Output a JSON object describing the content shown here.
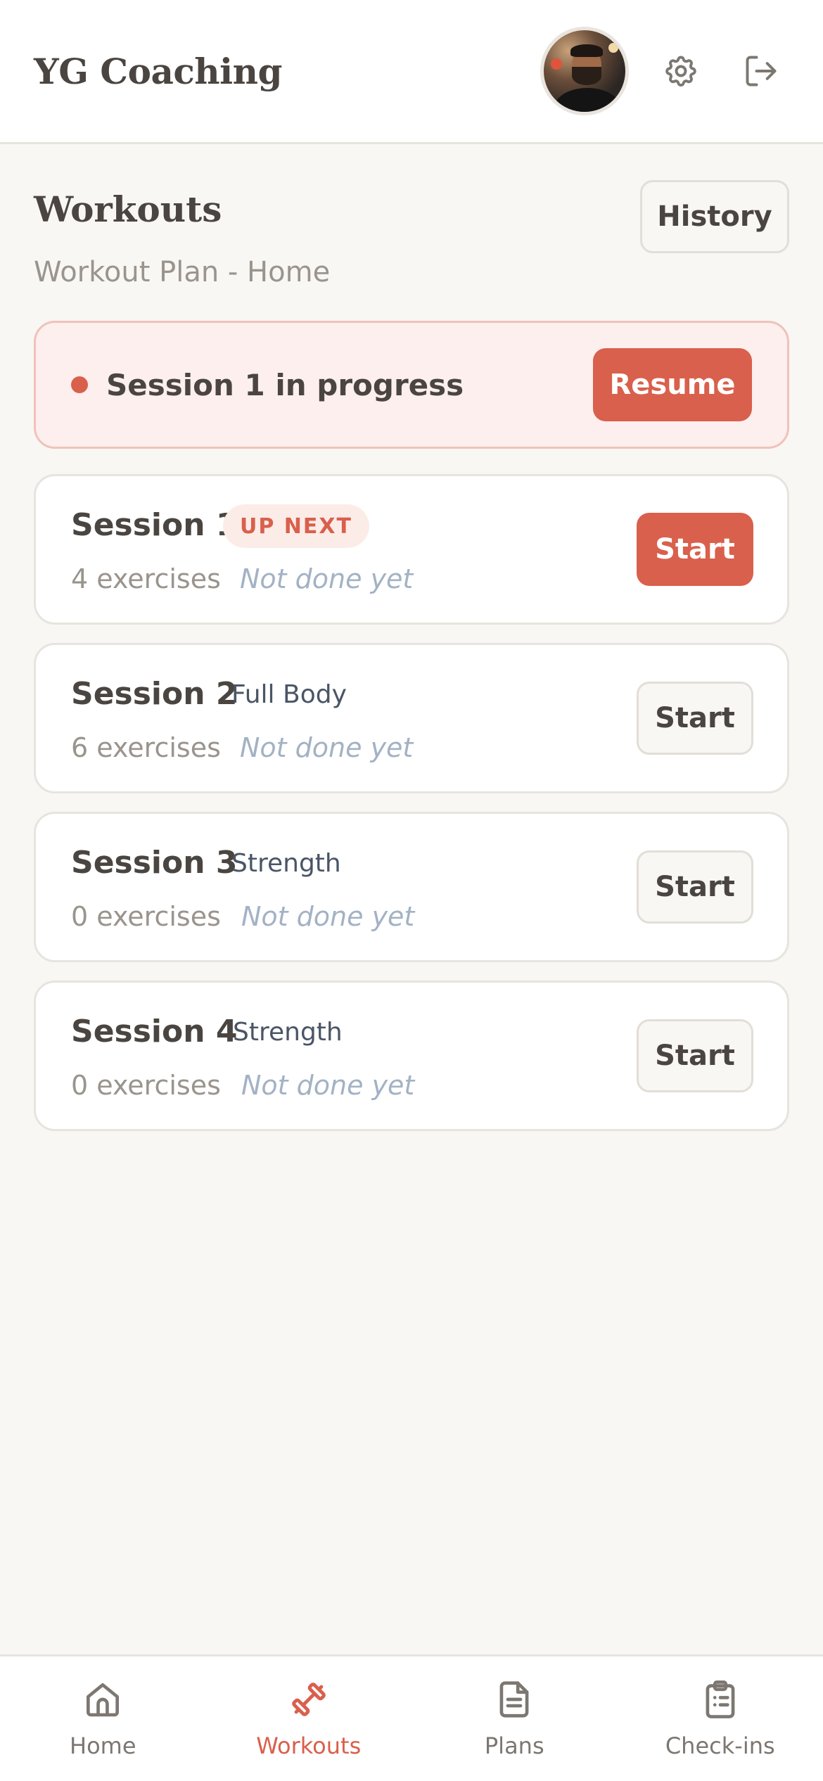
{
  "header": {
    "brand": "YG Coaching",
    "avatar_icon": "user-avatar-photo",
    "settings_icon": "gear-icon",
    "logout_icon": "logout-icon"
  },
  "page": {
    "title": "Workouts",
    "subtitle": "Workout Plan - Home",
    "history_label": "History"
  },
  "progress_banner": {
    "text": "Session 1 in progress",
    "resume_label": "Resume"
  },
  "sessions": [
    {
      "name": "Session 1",
      "badge": "UP NEXT",
      "exercises": "4 exercises",
      "status": "Not done yet",
      "start_label": "Start",
      "primary": true
    },
    {
      "name": "Session 2",
      "tag": "Full Body",
      "exercises": "6 exercises",
      "status": "Not done yet",
      "start_label": "Start"
    },
    {
      "name": "Session 3",
      "tag": "Strength",
      "exercises": "0 exercises",
      "status": "Not done yet",
      "start_label": "Start"
    },
    {
      "name": "Session 4",
      "tag": "Strength",
      "exercises": "0 exercises",
      "status": "Not done yet",
      "start_label": "Start"
    }
  ],
  "nav": {
    "items": [
      {
        "label": "Home",
        "icon": "home-icon"
      },
      {
        "label": "Workouts",
        "icon": "dumbbell-icon",
        "active": true
      },
      {
        "label": "Plans",
        "icon": "document-icon"
      },
      {
        "label": "Check-ins",
        "icon": "clipboard-icon"
      }
    ]
  },
  "colors": {
    "accent": "#d9604c",
    "background": "#f8f7f4",
    "banner_bg": "#fcefed",
    "status_text": "#a3b2c4"
  }
}
